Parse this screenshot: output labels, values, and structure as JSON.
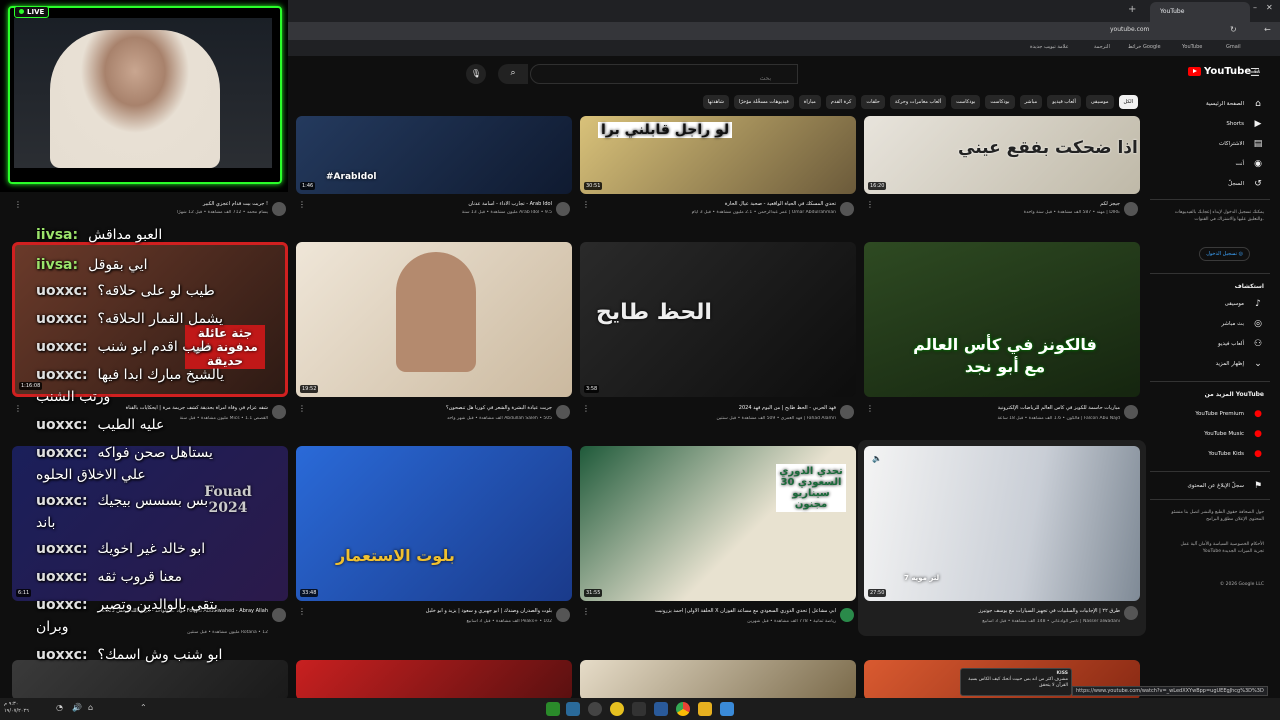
{
  "browser": {
    "tab_title": "YouTube",
    "url": "youtube.com",
    "status_url": "https://www.youtube.com/watch?v=_wLedXXYwBpp=ugUEEgJhcg%3D%3D",
    "bookmarks": [
      "Gmail",
      "YouTube",
      "خرائط Google",
      "الترجمة",
      "علامة تبويب جديدة"
    ]
  },
  "header": {
    "logo": "YouTube",
    "region": "SA",
    "search_placeholder": "بحث"
  },
  "chips": [
    "الكل",
    "موسيقى",
    "ألعاب فيديو",
    "مباشر",
    "بودكاست",
    "بودكاست",
    "ألعاب مغامرات وحركة",
    "حلقات",
    "كرة القدم",
    "مباراة",
    "فيديوهات مسحَّلة مؤخرًا",
    "شاهدتها"
  ],
  "sidebar": {
    "items": [
      {
        "label": "الصفحة الرئيسية",
        "icon": "home-icon"
      },
      {
        "label": "Shorts",
        "icon": "shorts-icon"
      },
      {
        "label": "الاشتراكات",
        "icon": "subscriptions-icon"
      },
      {
        "label": "أنت",
        "icon": "you-icon"
      },
      {
        "label": "السجلّ",
        "icon": "history-icon"
      }
    ],
    "signin_prompt": "يمكنك تسجيل الدخول لإبداء إعجابك بالفيديوهات والتعليق عليها والاشتراك في القنوات.",
    "signin_button": "تسجيل الدخول",
    "explore_heading": "استكشاف",
    "explore": [
      {
        "label": "موسيقى",
        "icon": "music-icon"
      },
      {
        "label": "بث مباشر",
        "icon": "live-icon"
      },
      {
        "label": "ألعاب فيديو",
        "icon": "gaming-icon"
      },
      {
        "label": "إظهار المزيد",
        "icon": "chevron-down-icon"
      }
    ],
    "more_heading": "المزيد من YouTube",
    "more": [
      {
        "label": "YouTube Premium"
      },
      {
        "label": "YouTube Music"
      },
      {
        "label": "YouTube Kids"
      }
    ],
    "report": "سجلّ الإبلاغ عن المحتوى",
    "footer1": "حول  الصحافة  حقوق الطبع والنشر  اتصل بنا  منشئو المحتوى  الإعلان  مطوّرو البرامج",
    "footer2": "الأحكام  الخصوصية  السياسة والأمان  آلية عمل YouTube  تجربة الميزات الجديدة",
    "copyright": "© 2026 Google LLC"
  },
  "videos": [
    {
      "title": "جيجز لكم",
      "channel": "DIRE | مهند",
      "meta": "587 ألف مشاهدة • قبل سنة واحدة",
      "duration": "16:20",
      "overlay": "اذا ضحكت بفقع عيني"
    },
    {
      "title": "تحدي المسكك في الحياة الواقعية - صحبة عيال الحارة",
      "channel": "Omar Abdulrahman | عمر عبدالرحمن",
      "meta": "2.1 مليون مشاهدة • قبل 3 أيام",
      "duration": "30:51",
      "overlay": "لو راجل قابلني برا"
    },
    {
      "title": "تجارب الاداء - أسامة عدنان - Arab Idol",
      "channel": "Arab Idol",
      "meta": "9.5 مليون مشاهدة • قبل 13 سنة",
      "duration": "1:46",
      "overlay": "#ArabIdol"
    },
    {
      "title": "جربت بيت قدام اعجزي الكبير !",
      "channel": "يسام محمد",
      "meta": "712 ألف مشاهدة • قبل 12 شهرًا",
      "duration": "",
      "overlay": ""
    },
    {
      "title": "مباريات حاسمة للكويز في كأس العالم للرياضات الإلكترونية",
      "channel": "Falcon Abu Najd | فالكون",
      "meta": "1.6 ألف مشاهدة • قبل 18 ساعة",
      "duration": "",
      "overlay": "فالكونز في كأس العالم مع أبو نجد"
    },
    {
      "title": "فهد الحربي - الحظ طايح | من ألبوم فهد 2024",
      "channel": "Fahad Alamri | فهد العمري",
      "meta": "509 ألف مشاهدة • قبل سنتين",
      "duration": "3:58",
      "overlay": "الحظ طايح"
    },
    {
      "title": "جربت عيادة البشرة والشعر في كوريا  هل تنصحون؟",
      "channel": "Abdullah Saleh",
      "meta": "505 ألف مشاهدة • قبل شهر واحد",
      "duration": "19:52",
      "overlay": ""
    },
    {
      "title": "شقه عزام في وفاة امرأة بحديقة كشف جريمة مرة | ايحكايات بالقناة",
      "channel": "القصص Mics",
      "meta": "1.1 مليون مشاهدة • قبل سنة",
      "duration": "1:16:08",
      "overlay": "جثة عائلة مدفونة في حديقة"
    },
    {
      "title": "طرق ٢٢ | الإجابيات والسلبيات في تجهيز السيارات مع يوسف جوتيرز",
      "channel": "Nasser alwadani | ناصر الوادعاني",
      "meta": "148 ألف مشاهدة • قبل 3 أسابيع",
      "duration": "27:50",
      "overlay": "7 لتر مويه"
    },
    {
      "title": "الحلقة الأولى| احمد يزرونيت X أبي مشاعل | تحدي الدوري السعودي مع مساعد الفوزان",
      "channel": "رياضة ثمانية",
      "meta": "778 ألف مشاهدة • قبل شهرين",
      "duration": "31:55",
      "overlay": "تحدي الدوري السعودي 30 سيناريو مجنون"
    },
    {
      "title": "بلوت والصدران وصندك | ابو جهيري و سعود | يزيد و ابو خليل",
      "channel": "Peaks+",
      "meta": "102 ألف مشاهدة • قبل 3 أسابيع",
      "duration": "33:48",
      "overlay": "بلوت الاستعمار"
    },
    {
      "title": "فؤاد عبدالواحد - ابراي الله | حفل 2023 Fouad Abdulwahed - Abray Allah",
      "channel": "Rotana",
      "meta": "12 مليون مشاهدة • قبل سنتين",
      "duration": "6:11",
      "overlay": "Fouad 2024"
    }
  ],
  "stream": {
    "live_label": "LIVE"
  },
  "chat": [
    {
      "user": "iivsa:",
      "text": "العبو مداقش",
      "green": true
    },
    {
      "user": "iivsa:",
      "text": "ايي بقوقل",
      "green": true
    },
    {
      "user": "uoxxc:",
      "text": "طيب لو على حلاقه؟",
      "green": false
    },
    {
      "user": "uoxxc:",
      "text": "يشمل القمار الحلاقه؟",
      "green": false
    },
    {
      "user": "uoxxc:",
      "text": "طيب اقدم ابو شنب",
      "green": false
    },
    {
      "user": "uoxxc:",
      "text": "يالشيخ مبارك ابدا فيها",
      "green": false
    },
    {
      "user": "",
      "text": "ورتب الشنب",
      "green": false
    },
    {
      "user": "uoxxc:",
      "text": "عليه الطيب",
      "green": false
    },
    {
      "user": "uoxxc:",
      "text": "يستاهل صحن فواكه",
      "green": false
    },
    {
      "user": "",
      "text": "علي الاخلاق الحلوه",
      "green": false
    },
    {
      "user": "uoxxc:",
      "text": "بس بسسس بيجيك",
      "green": false
    },
    {
      "user": "",
      "text": "باند",
      "green": false
    },
    {
      "user": "uoxxc:",
      "text": "ابو خالد غير اخويك",
      "green": false
    },
    {
      "user": "uoxxc:",
      "text": "معنا قروب ثقه",
      "green": false
    },
    {
      "user": "uoxxc:",
      "text": "بتقي بالوالدين وتصير",
      "green": false
    },
    {
      "user": "",
      "text": "وبران",
      "green": false
    },
    {
      "user": "uoxxc:",
      "text": "ابو شنب وش اسمك؟",
      "green": false
    }
  ],
  "notification": {
    "user": "KISS",
    "text": "مشرف اكثر من انه بس حبيت أتحك كيف الكاس بسبة القرآن لا يتحقق"
  },
  "taskbar": {
    "clock": "٩:٣٠ م",
    "date": "١٩/٠٧/٢٠٢٦"
  }
}
